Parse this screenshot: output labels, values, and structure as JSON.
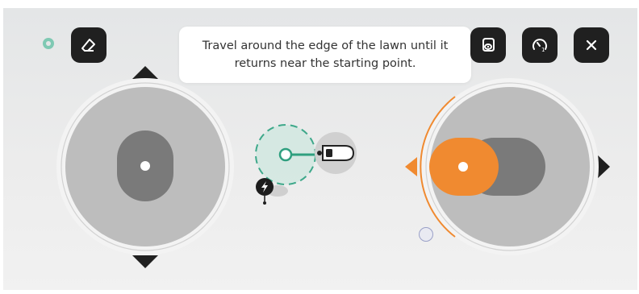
{
  "instruction": {
    "line1": "Travel around the edge of the lawn until it",
    "line2": "returns near the starting point."
  },
  "toolbar_left": {
    "status_icon": "ring-status-icon",
    "eraser_icon": "eraser-icon"
  },
  "toolbar_right": {
    "icons": [
      "eye-view-icon",
      "speed-gauge-icon",
      "close-icon"
    ]
  },
  "colors": {
    "accent": "#f08a30",
    "path_green": "#2f9f7f",
    "button_bg": "#202020",
    "joystick_track": "#bdbdbd"
  }
}
